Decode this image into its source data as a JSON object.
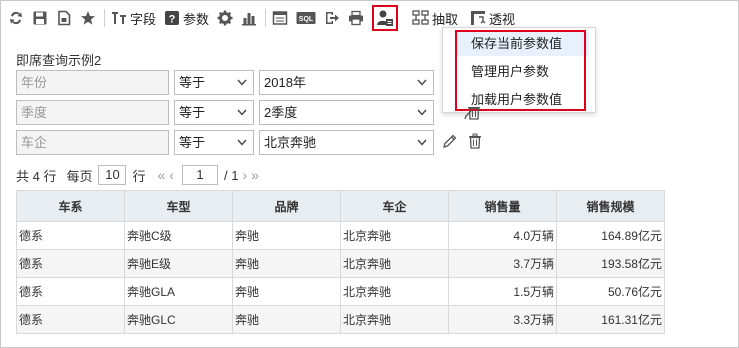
{
  "toolbar": {
    "fields_label": "字段",
    "params_label": "参数",
    "sql_icon_text": "SQL",
    "extract_label": "抽取",
    "pivot_label": "透视"
  },
  "user_params_menu": {
    "items": [
      {
        "label": "保存当前参数值"
      },
      {
        "label": "管理用户参数"
      },
      {
        "label": "加载用户参数值"
      }
    ]
  },
  "query": {
    "title": "即席查询示例2",
    "rows": [
      {
        "field": "年份",
        "operator": "等于",
        "value": "2018年"
      },
      {
        "field": "季度",
        "operator": "等于",
        "value": "2季度"
      },
      {
        "field": "车企",
        "operator": "等于",
        "value": "北京奔驰"
      }
    ]
  },
  "pager": {
    "total_text": "共 4 行",
    "per_page_label": "每页",
    "per_page": "10",
    "rows_unit": "行",
    "first": "«",
    "prev": "‹",
    "page": "1",
    "of_pages": "/ 1",
    "next": "›",
    "last": "»"
  },
  "table": {
    "columns": [
      "车系",
      "车型",
      "品牌",
      "车企",
      "销售量",
      "销售规模"
    ],
    "rows": [
      [
        "德系",
        "奔驰C级",
        "奔驰",
        "北京奔驰",
        "4.0万辆",
        "164.89亿元"
      ],
      [
        "德系",
        "奔驰E级",
        "奔驰",
        "北京奔驰",
        "3.7万辆",
        "193.58亿元"
      ],
      [
        "德系",
        "奔驰GLA",
        "奔驰",
        "北京奔驰",
        "1.5万辆",
        "50.76亿元"
      ],
      [
        "德系",
        "奔驰GLC",
        "奔驰",
        "北京奔驰",
        "3.3万辆",
        "161.31亿元"
      ]
    ]
  },
  "colors": {
    "highlight_red": "#e0001b",
    "header_bg": "#e8edf2",
    "hover_bg": "#e8f0fb"
  }
}
